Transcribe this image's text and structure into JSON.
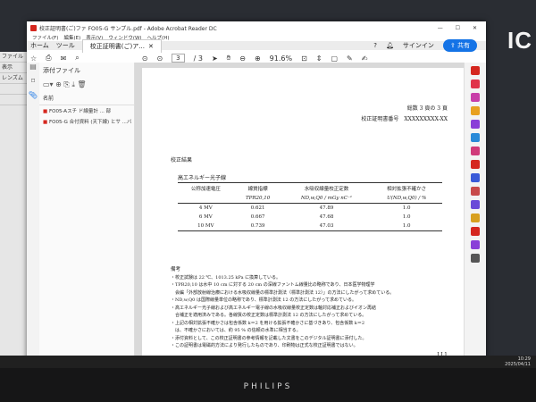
{
  "window": {
    "title": "校正証明書(ご)ファ FO05-G サンプル.pdf - Adobe Acrobat Reader DC",
    "menu": [
      "ファイル(F)",
      "編集(E)",
      "表示(V)",
      "ウィンドウ(W)",
      "ヘルプ(H)"
    ],
    "tabs": {
      "home": "ホーム",
      "tools": "ツール",
      "doc": "校正証明書(ご)ア..."
    },
    "signin": "サインイン",
    "share": "共有"
  },
  "toolbar": {
    "page_current": "3",
    "page_total": "/ 3",
    "zoom": "91.6%"
  },
  "attachments": {
    "title": "添付ファイル",
    "column": "名前",
    "files": [
      "FO05-Aスチ ド線量計 ... 部",
      "FO05-G 合付資料 (天下線) とサ ...バ"
    ]
  },
  "document": {
    "page_label": "総数 3 頁の 3 頁",
    "cert_label": "校正証明書番号　XXXXXXXXX-XX",
    "section": "校正結果",
    "subtitle": "高エネルギー光子線",
    "table": {
      "headers1": [
        "公称加速電圧",
        "線質指標",
        "水吸収線量校正定数",
        "相対拡張不確かさ"
      ],
      "headers2": [
        "",
        "TPR20,10",
        "ND,w,Q0 / mGy nC⁻¹",
        "U(ND,w,Q0) / %"
      ],
      "rows": [
        [
          "4 MV",
          "0.621",
          "47.89",
          "1.0"
        ],
        [
          "6 MV",
          "0.667",
          "47.68",
          "1.0"
        ],
        [
          "10 MV",
          "0.739",
          "47.03",
          "1.0"
        ]
      ]
    },
    "notes_title": "備考",
    "notes": [
      "・校正試験は 22 ℃、1013.25 kPa に換算している。",
      "・TPR20,10 は水中 10 cm に対する 20 cm の深線ファントム線量比の略称であり、日本医学物理学",
      "　会編「外部放射線治療における水吸収線量の標準計測法（標準計測法 12）」の方法にしたがって求めている。",
      "・ND,w,Q0 は国際線量単位の略称であり、標準計測法 12 の方法にしたがって求めている。",
      "・高エネルギー光子線および高エネルギー電子線の水吸収線量校正定数は軸対応補正およびイオン再結",
      "　合補正を適用済みである。各線質の校正定数は標準計測法 12 の方法にしたがって求めている。",
      "・上記の相対拡張不確かさは包含係数 k＝2 を用ける拡張不確かさに基づきあり、包含係数 k＝2",
      "　は、不確かさにおいては、約 95 % の信頼の水準に相当する。",
      "・添付資料として、この校正証明書の参考情報を記載した文書をこのデジタル証明書に添付した。",
      "・この証明書は電磁的方法により発行したものであり、印刷物は正式な校正証明書ではない。"
    ],
    "footer": "LL1"
  },
  "taskbar": {
    "time": "10:29",
    "date": "2025/04/11"
  },
  "brand": {
    "monitor": "PHILIPS",
    "wall_logo": "IC"
  },
  "colors": {
    "accent": "#1473e6",
    "pdf_red": "#d5271f"
  }
}
